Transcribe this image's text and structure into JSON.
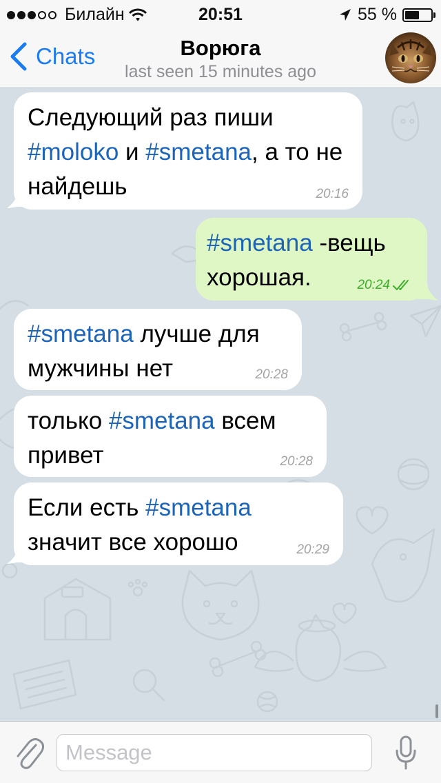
{
  "status_bar": {
    "carrier": "Билайн",
    "time": "20:51",
    "battery": "55 %",
    "battery_level": 0.55,
    "icons": [
      "signal-dots",
      "wifi-icon",
      "location-arrow-icon",
      "battery-icon"
    ]
  },
  "header": {
    "back_label": "Chats",
    "title": "Ворюга",
    "subtitle": "last seen 15 minutes ago",
    "back_icon": "chevron-left-icon",
    "avatar": "cat-avatar"
  },
  "messages": [
    {
      "direction": "in",
      "parts": [
        {
          "text": "Следующий раз пиши "
        },
        {
          "text": "#moloko",
          "hashtag": true
        },
        {
          "text": " и "
        },
        {
          "text": "#smetana",
          "hashtag": true
        },
        {
          "text": ", а то не найдешь"
        }
      ],
      "time": "20:16"
    },
    {
      "direction": "out",
      "parts": [
        {
          "text": "#smetana",
          "hashtag": true
        },
        {
          "text": " -вещь хорошая."
        }
      ],
      "time": "20:24",
      "status_icon": "double-check-icon"
    },
    {
      "direction": "in",
      "parts": [
        {
          "text": "#smetana",
          "hashtag": true
        },
        {
          "text": " лучше для мужчины нет"
        }
      ],
      "time": "20:28"
    },
    {
      "direction": "in",
      "parts": [
        {
          "text": "только "
        },
        {
          "text": "#smetana",
          "hashtag": true
        },
        {
          "text": " всем привет"
        }
      ],
      "time": "20:28"
    },
    {
      "direction": "in",
      "parts": [
        {
          "text": "Если есть "
        },
        {
          "text": "#smetana",
          "hashtag": true
        },
        {
          "text": " значит все хорошо"
        }
      ],
      "time": "20:29"
    }
  ],
  "input_bar": {
    "placeholder": "Message",
    "value": "",
    "attach_icon": "paperclip-icon",
    "mic_icon": "microphone-icon"
  },
  "colors": {
    "accent": "#1b7cf2",
    "hashtag": "#1c64b9",
    "incoming_bubble": "#ffffff",
    "outgoing_bubble": "#dff7c5",
    "outgoing_time": "#3dae2b",
    "chat_background": "#d5dee5"
  }
}
